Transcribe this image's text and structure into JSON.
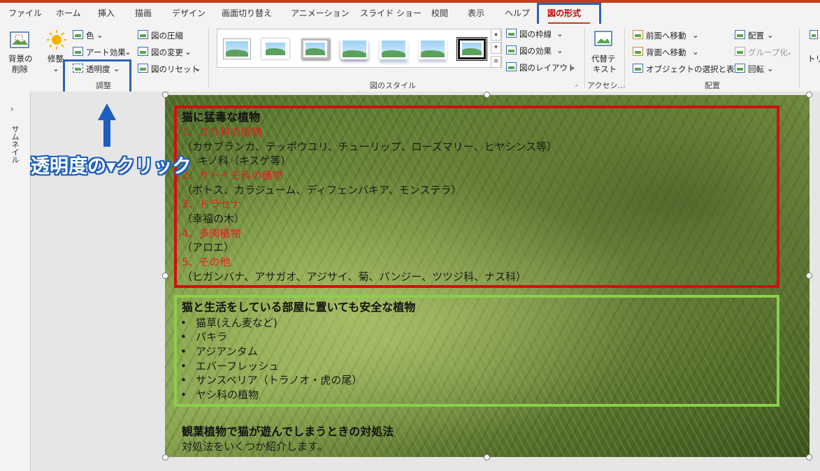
{
  "colors": {
    "accent": "#c43e1c",
    "highlight_box": "#2a63b8",
    "red_frame": "#d01010",
    "green_frame": "#8ccf4d",
    "red_text": "#e02020"
  },
  "menu": {
    "tabs": [
      "ファイル",
      "ホーム",
      "挿入",
      "描画",
      "デザイン",
      "画面切り替え",
      "アニメーション",
      "スライド ショー",
      "校閲",
      "表示",
      "ヘルプ",
      "図の形式"
    ],
    "active": "図の形式"
  },
  "ribbon": {
    "remove_bg_line1": "背景の",
    "remove_bg_line2": "削除",
    "corrections": "修整",
    "color": "色",
    "artistic": "アート効果",
    "transparency": "透明度",
    "compress": "図の圧縮",
    "change": "図の変更",
    "reset": "図のリセット",
    "adjust_group": "調整",
    "border": "図の枠線",
    "effects": "図の効果",
    "layout": "図のレイアウト",
    "styles_group": "図のスタイル",
    "alt_line1": "代替テ",
    "alt_line2": "キスト",
    "access_group": "アクセシ…",
    "bring_forward": "前面へ移動",
    "send_backward": "背面へ移動",
    "selection_pane": "オブジェクトの選択と表示",
    "align": "配置",
    "group": "グループ化",
    "rotate": "回転",
    "arrange_group": "配置",
    "crop": "トリ"
  },
  "sidebar": {
    "label": "サムネイル",
    "chevron": "›"
  },
  "callout": {
    "text": "透明度の▾クリック"
  },
  "slide": {
    "section1": {
      "title": "猫に猛毒な植物",
      "lines": [
        {
          "text": "1、ユリ科の植物",
          "red": true
        },
        {
          "text": "（カサブランカ、テッポウユリ、チューリップ、ローズマリー、ヒヤシンス等）",
          "red": false
        },
        {
          "text": "キノ科（キスゲ等）",
          "red": false
        },
        {
          "text": "2、サトイモ科の植物",
          "red": true
        },
        {
          "text": "（ポトス、カラジューム、ディフェンバキア、モンステラ）",
          "red": false
        },
        {
          "text": "3、ドラセナ",
          "red": true
        },
        {
          "text": "（幸福の木）",
          "red": false
        },
        {
          "text": "4、多肉植物",
          "red": true
        },
        {
          "text": "（アロエ）",
          "red": false
        },
        {
          "text": "5、その他",
          "red": true
        },
        {
          "text": "（ヒガンバナ、アサガオ、アジサイ、菊、パンジー、ツツジ科、ナス科）",
          "red": false
        }
      ]
    },
    "section2": {
      "title": "猫と生活をしている部屋に置いても安全な植物",
      "items": [
        "猫草(えん麦など)",
        "パキラ",
        "アジアンタム",
        "エバーフレッシュ",
        "サンスベリア（トラノオ・虎の尾）",
        "ヤシ科の植物"
      ]
    },
    "section3": {
      "title": "観葉植物で猫が遊んでしまうときの対処法",
      "body": "対処法をいくつか紹介します。"
    }
  }
}
